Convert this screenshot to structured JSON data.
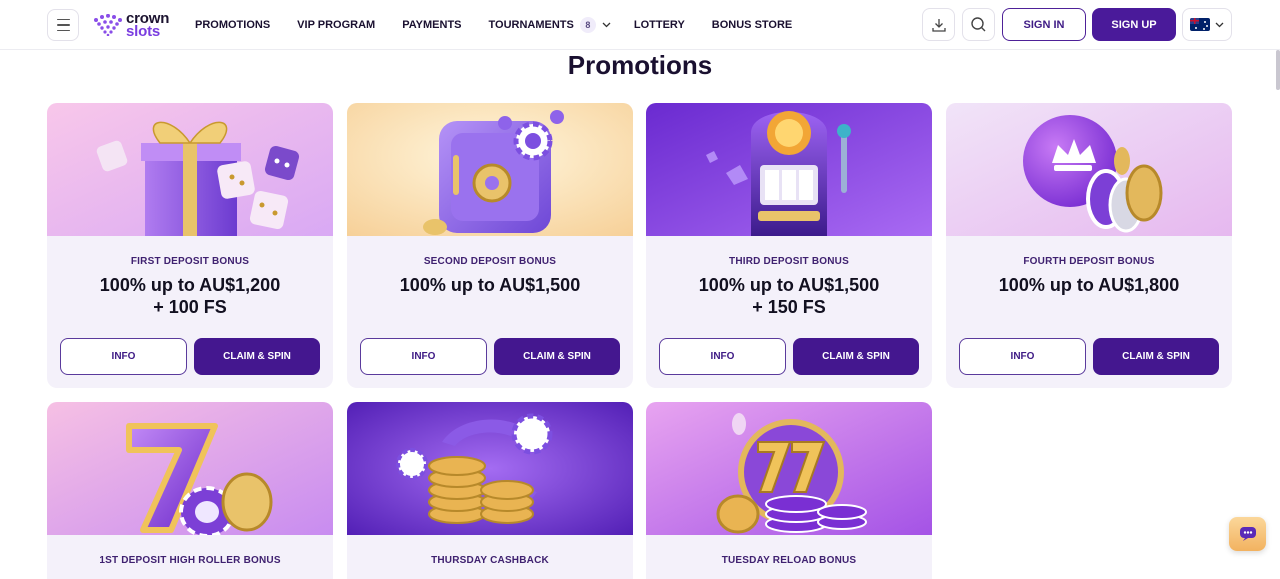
{
  "brand": {
    "line1": "crown",
    "line2": "slots"
  },
  "nav": [
    {
      "label": "PROMOTIONS"
    },
    {
      "label": "VIP PROGRAM"
    },
    {
      "label": "PAYMENTS"
    },
    {
      "label": "TOURNAMENTS",
      "badge": "8"
    },
    {
      "label": "LOTTERY"
    },
    {
      "label": "BONUS STORE"
    }
  ],
  "header": {
    "signin": "SIGN IN",
    "signup": "SIGN UP",
    "language_icon": "australia-flag-icon"
  },
  "page": {
    "title": "Promotions"
  },
  "colors": {
    "primary": "#44178f",
    "card_bg": "#f4f1fa",
    "accent": "#7a3de0"
  },
  "promotions": [
    {
      "label": "FIRST DEPOSIT BONUS",
      "amount_line1": "100% up to AU$1,200",
      "amount_line2": "+ 100 FS",
      "info": "INFO",
      "claim": "CLAIM & SPIN",
      "image": "gift-box-dice"
    },
    {
      "label": "SECOND DEPOSIT BONUS",
      "amount_line1": "100% up to AU$1,500",
      "amount_line2": "",
      "info": "INFO",
      "claim": "CLAIM & SPIN",
      "image": "safe-chips"
    },
    {
      "label": "THIRD DEPOSIT BONUS",
      "amount_line1": "100% up to AU$1,500",
      "amount_line2": "+ 150 FS",
      "info": "INFO",
      "claim": "CLAIM & SPIN",
      "image": "slot-machine"
    },
    {
      "label": "FOURTH DEPOSIT BONUS",
      "amount_line1": "100% up to AU$1,800",
      "amount_line2": "",
      "info": "INFO",
      "claim": "CLAIM & SPIN",
      "image": "crown-chip"
    },
    {
      "label": "1ST DEPOSIT HIGH ROLLER BONUS",
      "image": "lucky-seven"
    },
    {
      "label": "THURSDAY CASHBACK",
      "image": "coins-arrows"
    },
    {
      "label": "TUESDAY RELOAD BONUS",
      "image": "seven-seven-chips"
    }
  ]
}
